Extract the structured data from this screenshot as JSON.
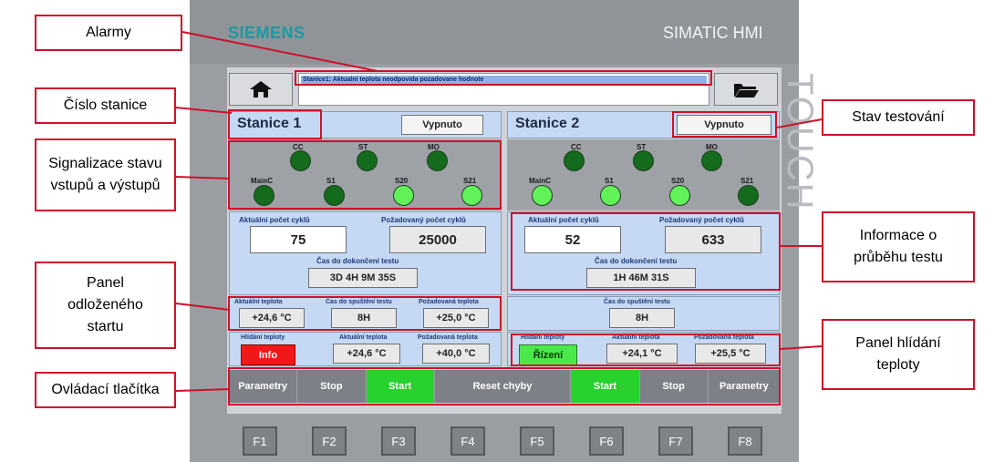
{
  "device": {
    "brand": "SIEMENS",
    "product": "SIMATIC HMI",
    "side_label": "TOUCH"
  },
  "alarm": {
    "message": "Stanice1: Aktualni teplota neodpovida pozadovane hodnote"
  },
  "stations": [
    {
      "title": "Stanice 1",
      "state_button": "Vypnuto",
      "io_top": [
        {
          "label": "CC",
          "on": false
        },
        {
          "label": "ST",
          "on": false
        },
        {
          "label": "MO",
          "on": false
        }
      ],
      "io_bottom": [
        {
          "label": "MainC",
          "on": false
        },
        {
          "label": "S1",
          "on": false
        },
        {
          "label": "S20",
          "on": true
        },
        {
          "label": "S21",
          "on": true
        }
      ],
      "current_cycles_label": "Aktuální počet cyklů",
      "current_cycles": "75",
      "required_cycles_label": "Požadovaný počet cyklů",
      "required_cycles": "25000",
      "time_to_finish_label": "Čas do dokončení testu",
      "time_to_finish": "3D 4H 9M 35S",
      "delayed_start": {
        "has_panel": true,
        "current_temp_label": "Aktuální teplota",
        "current_temp": "+24,6 °C",
        "time_to_start_label": "Čas do spuštění testu",
        "time_to_start": "8H",
        "required_temp_label": "Požadovaná teplota",
        "required_temp": "+25,0 °C"
      },
      "temp_guard": {
        "guard_label": "Hlídání teploty",
        "guard_state": "Info",
        "guard_color": "#f01818",
        "current_temp_label": "Aktuální teplota",
        "current_temp": "+24,6 °C",
        "required_temp_label": "Požadovaná teplota",
        "required_temp": "+40,0 °C"
      }
    },
    {
      "title": "Stanice 2",
      "state_button": "Vypnuto",
      "io_top": [
        {
          "label": "CC",
          "on": false
        },
        {
          "label": "ST",
          "on": false
        },
        {
          "label": "MO",
          "on": false
        }
      ],
      "io_bottom": [
        {
          "label": "MainC",
          "on": true
        },
        {
          "label": "S1",
          "on": true
        },
        {
          "label": "S20",
          "on": true
        },
        {
          "label": "S21",
          "on": false
        }
      ],
      "current_cycles_label": "Aktuální počet cyklů",
      "current_cycles": "52",
      "required_cycles_label": "Požadovaný počet cyklů",
      "required_cycles": "633",
      "time_to_finish_label": "Čas do dokončení testu",
      "time_to_finish": "1H 46M 31S",
      "delayed_start": {
        "time_to_start_label": "Čas do spuštění testu",
        "time_to_start": "8H"
      },
      "temp_guard": {
        "guard_label": "Hlídání teploty",
        "guard_state": "Řízení",
        "guard_color": "#4be84b",
        "current_temp_label": "Aktuální teplota",
        "current_temp": "+24,1 °C",
        "required_temp_label": "Požadovaná teplota",
        "required_temp": "+25,5 °C"
      }
    }
  ],
  "control_buttons": [
    {
      "label": "Parametry",
      "active": false
    },
    {
      "label": "Stop",
      "active": false
    },
    {
      "label": "Start",
      "active": true
    },
    {
      "label": "Reset chyby",
      "active": false
    },
    {
      "label": "Start",
      "active": true
    },
    {
      "label": "Stop",
      "active": false
    },
    {
      "label": "Parametry",
      "active": false
    }
  ],
  "function_keys": [
    "F1",
    "F2",
    "F3",
    "F4",
    "F5",
    "F6",
    "F7",
    "F8"
  ],
  "callouts": {
    "alarmy": "Alarmy",
    "cislo_stanice": "Číslo stanice",
    "signalizace_1": "Signalizace stavu",
    "signalizace_2": "vstupů a výstupů",
    "panel_odlozeneho_1": "Panel",
    "panel_odlozeneho_2": "odloženého",
    "panel_odlozeneho_3": "startu",
    "ovladaci_tlacitka": "Ovládací tlačítka",
    "stav_testovani": "Stav testování",
    "informace_1": "Informace o",
    "informace_2": "průběhu testu",
    "panel_hlidani_1": "Panel hlídání",
    "panel_hlidani_2": "teploty"
  }
}
